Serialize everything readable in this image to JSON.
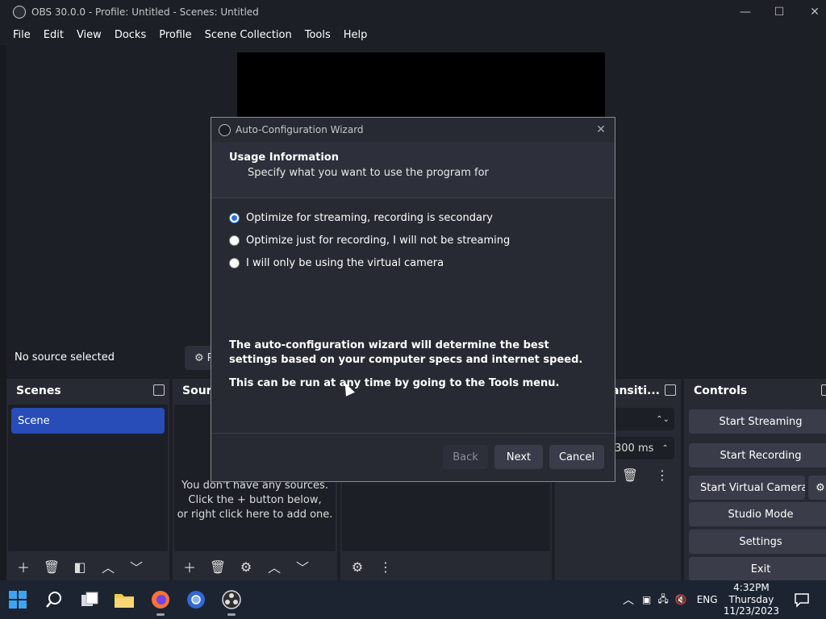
{
  "window": {
    "title": "OBS 30.0.0 - Profile: Untitled - Scenes: Untitled"
  },
  "menu": [
    "File",
    "Edit",
    "View",
    "Docks",
    "Profile",
    "Scene Collection",
    "Tools",
    "Help"
  ],
  "status": {
    "no_source": "No source selected",
    "properties_label": "Pr"
  },
  "docks": {
    "scenes": {
      "title": "Scenes",
      "items": [
        "Scene"
      ]
    },
    "sources": {
      "title": "Sourc",
      "empty_line1": "You don't have any sources.",
      "empty_line2": "Click the + button below,",
      "empty_line3": "or right click here to add one."
    },
    "transitions": {
      "title": "ansiti...",
      "duration": "300 ms"
    },
    "controls": {
      "title": "Controls",
      "start_streaming": "Start Streaming",
      "start_recording": "Start Recording",
      "start_virtual_camera": "Start Virtual Camera",
      "studio_mode": "Studio Mode",
      "settings": "Settings",
      "exit": "Exit"
    }
  },
  "dialog": {
    "title": "Auto-Configuration Wizard",
    "heading": "Usage Information",
    "subheading": "Specify what you want to use the program for",
    "options": [
      "Optimize for streaming, recording is secondary",
      "Optimize just for recording, I will not be streaming",
      "I will only be using the virtual camera"
    ],
    "selected_option": 0,
    "info1": "The auto-configuration wizard will determine the best settings based on your computer specs and internet speed.",
    "info2": "This can be run at any time by going to the Tools menu.",
    "back": "Back",
    "next": "Next",
    "cancel": "Cancel"
  },
  "taskbar": {
    "language": "ENG",
    "time": "4:32PM",
    "day": "Thursday",
    "date": "11/23/2023"
  },
  "colors": {
    "accent": "#284cb8",
    "background": "#1d1f26",
    "dock": "#272a33",
    "button": "#3a3d49"
  }
}
